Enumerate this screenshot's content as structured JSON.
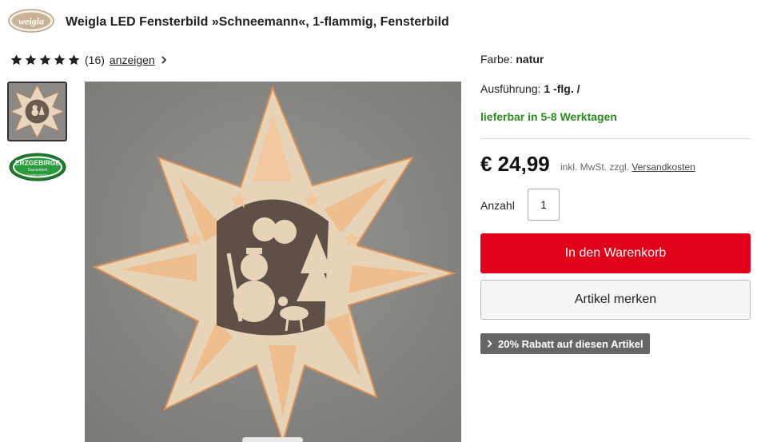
{
  "header": {
    "brand": "weigla",
    "title": "Weigla LED Fensterbild »Schneemann«, 1-flammig, Fensterbild"
  },
  "rating": {
    "stars": 5,
    "max_stars": 5,
    "count": "(16)",
    "link_label": "anzeigen"
  },
  "gallery": {
    "seal_top": "ERZGEBIRGE",
    "seal_sub": "Garantiert",
    "seal_small": "Tradition erleben",
    "active_index": 0
  },
  "details": {
    "color_label": "Farbe:",
    "color_value": "natur",
    "variant_label": "Ausführung:",
    "variant_value": "1 -flg. /",
    "availability": "lieferbar in 5-8 Werktagen"
  },
  "price": {
    "amount": "€ 24,99",
    "tax_note": "inkl. MwSt. zzgl.",
    "shipping_link": "Versandkosten"
  },
  "quantity": {
    "label": "Anzahl",
    "value": "1"
  },
  "actions": {
    "add_to_cart": "In den Warenkorb",
    "wishlist": "Artikel merken",
    "discount": "20% Rabatt auf diesen Artikel"
  },
  "colors": {
    "accent_red": "#e1001a",
    "availability_green": "#2e8b1f",
    "badge_gray": "#666666"
  }
}
